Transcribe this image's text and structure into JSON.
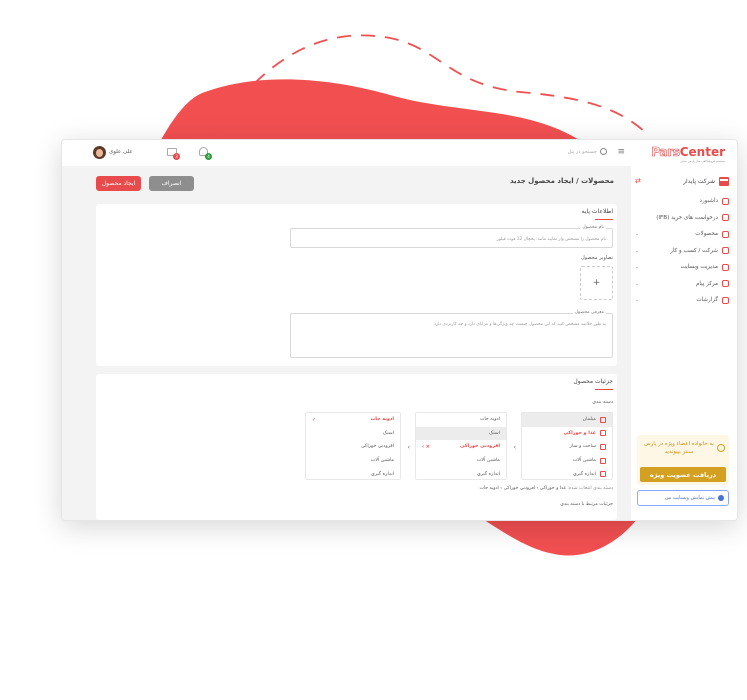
{
  "colors": {
    "accent": "#e84b4b",
    "gold": "#d4a021",
    "blue": "#4a6fd6",
    "blob": "#f24f51"
  },
  "brand": {
    "part1": "Pars",
    "part2": "Center",
    "tagline": "سیستم فروشگاهی ساز پارس سنتر"
  },
  "sidebar": {
    "company": "شرکت پایدار",
    "items": [
      {
        "label": "داشبورد",
        "icon": "dashboard-icon",
        "caret": false
      },
      {
        "label": "درخواست های خرید (IFB)",
        "icon": "cart-request-icon",
        "caret": false
      },
      {
        "label": "محصولات",
        "icon": "products-icon",
        "caret": true
      },
      {
        "label": "شرکت / کسب و کار",
        "icon": "business-icon",
        "caret": true
      },
      {
        "label": "مدیریت وبسایت",
        "icon": "website-icon",
        "caret": true
      },
      {
        "label": "مرکز پیام",
        "icon": "message-icon",
        "caret": true
      },
      {
        "label": "گزارشات",
        "icon": "reports-icon",
        "caret": true
      }
    ],
    "promo_text": "به خانواده اعضاء ویژه در پارس سنتر بپیوندید",
    "promo_button": "دریافت عضویت ویژه",
    "preview_label": "پیش نمایش وبسایت من"
  },
  "topbar": {
    "search_placeholder": "جستجو در پنل",
    "user_name": "علی علوی",
    "bell_count": "4",
    "mail_count": "3"
  },
  "page": {
    "title": "محصولات / ایجاد محصول جدید",
    "create_button": "ایجاد محصول",
    "cancel_button": "انصراف"
  },
  "basic": {
    "title": "اطلاعات پایه",
    "name_label": "نام محصول",
    "name_placeholder": "نام محصول را مشخص وار نمایید مانند: یخچال 12 فوت فیلور",
    "images_label": "تصاویر محصول",
    "add_symbol": "+",
    "desc_label": "معرفی محصول",
    "desc_placeholder": "به طور خلاصه مشخص کنید که این محصول چیست چه ویژگی‌ها و مزایای دارد و چه کاربردی دارد"
  },
  "details": {
    "title": "جزئیات محصول",
    "category_label": "دسته بندی",
    "col1": [
      {
        "label": "مبلمان",
        "red": false,
        "sel": true,
        "mark": ""
      },
      {
        "label": "غذا و خوراکی",
        "red": true,
        "sel": false,
        "mark": ""
      },
      {
        "label": "ساخت و ساز",
        "red": false,
        "sel": false,
        "mark": ""
      },
      {
        "label": "ماشین آلات",
        "red": false,
        "sel": false,
        "mark": ""
      },
      {
        "label": "اندازه گیری",
        "red": false,
        "sel": false,
        "mark": ""
      }
    ],
    "col2": [
      {
        "label": "ادویه جات",
        "red": false,
        "sel": false,
        "mark": ""
      },
      {
        "label": "اسنک",
        "red": false,
        "sel": true,
        "mark": ""
      },
      {
        "label": "افزودنی خوراکی",
        "red": true,
        "sel": false,
        "mark": "× ›"
      },
      {
        "label": "ماشین آلات",
        "red": false,
        "sel": false,
        "mark": ""
      },
      {
        "label": "اندازه گیری",
        "red": false,
        "sel": false,
        "mark": ""
      }
    ],
    "col3": [
      {
        "label": "ادویه جات",
        "red": true,
        "sel": false,
        "mark": "✓"
      },
      {
        "label": "اسنک",
        "red": false,
        "sel": false,
        "mark": ""
      },
      {
        "label": "افزودنی خوراکی",
        "red": false,
        "sel": false,
        "mark": ""
      },
      {
        "label": "ماشین آلات",
        "red": false,
        "sel": false,
        "mark": ""
      },
      {
        "label": "اندازه گیری",
        "red": false,
        "sel": false,
        "mark": ""
      }
    ],
    "col_arrow": "‹",
    "crumb_label": "دسته بندی انتخاب شده:",
    "crumb_parts": [
      "غذا و خوراکی",
      "افزودنی خوراکی",
      "ادویه جات"
    ],
    "crumb_sep": "›",
    "assoc_label": "جزئیات مرتبط با دسته بندی"
  }
}
